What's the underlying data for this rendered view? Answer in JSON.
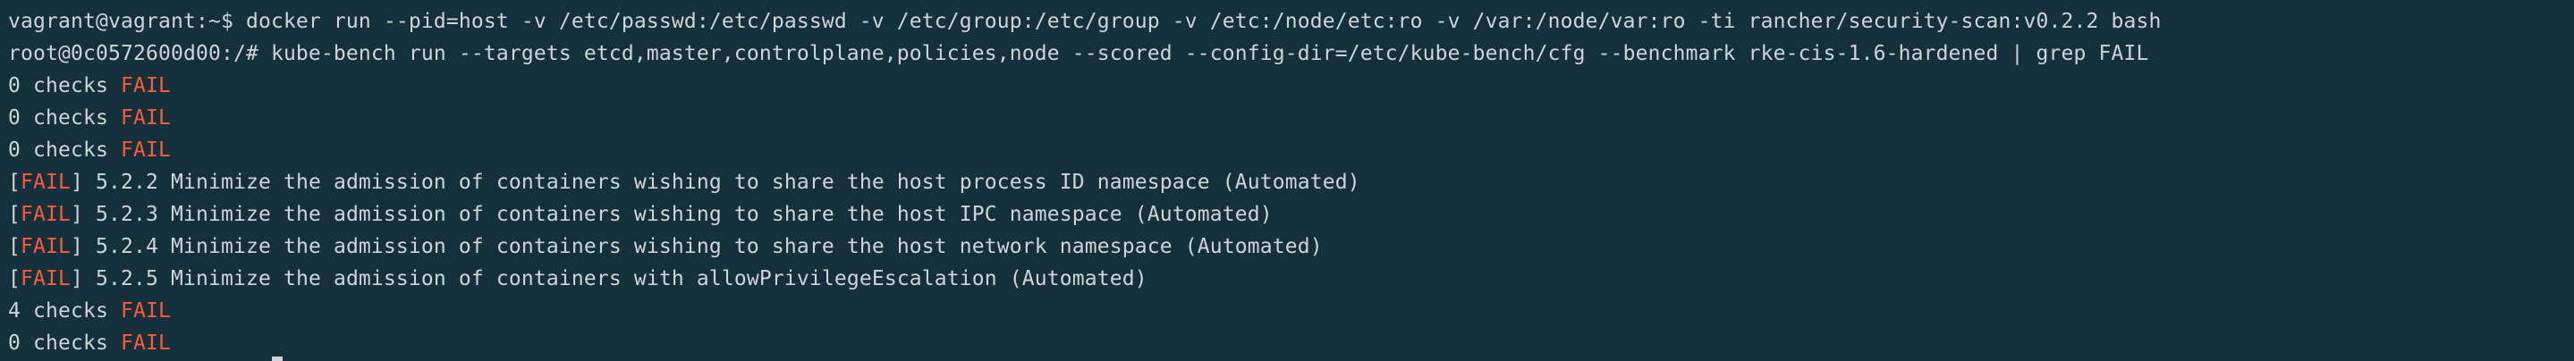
{
  "terminal": {
    "lines": [
      {
        "prefix": "vagrant@vagrant:~$ docker run --pid=host -v /etc/passwd:/etc/passwd -v /etc/group:/etc/group -v /etc:/node/etc:ro -v /var:/node/var:ro -ti rancher/security-scan:v0.2.2 bash",
        "fail": "",
        "suffix": ""
      },
      {
        "prefix": "root@0c0572600d00:/# kube-bench run --targets etcd,master,controlplane,policies,node --scored --config-dir=/etc/kube-bench/cfg --benchmark rke-cis-1.6-hardened | grep FAIL",
        "fail": "",
        "suffix": ""
      },
      {
        "prefix": "0 checks ",
        "fail": "FAIL",
        "suffix": ""
      },
      {
        "prefix": "0 checks ",
        "fail": "FAIL",
        "suffix": ""
      },
      {
        "prefix": "0 checks ",
        "fail": "FAIL",
        "suffix": ""
      },
      {
        "prefix": "[",
        "fail": "FAIL",
        "suffix": "] 5.2.2 Minimize the admission of containers wishing to share the host process ID namespace (Automated)"
      },
      {
        "prefix": "[",
        "fail": "FAIL",
        "suffix": "] 5.2.3 Minimize the admission of containers wishing to share the host IPC namespace (Automated)"
      },
      {
        "prefix": "[",
        "fail": "FAIL",
        "suffix": "] 5.2.4 Minimize the admission of containers wishing to share the host network namespace (Automated)"
      },
      {
        "prefix": "[",
        "fail": "FAIL",
        "suffix": "] 5.2.5 Minimize the admission of containers with allowPrivilegeEscalation (Automated)"
      },
      {
        "prefix": "4 checks ",
        "fail": "FAIL",
        "suffix": ""
      },
      {
        "prefix": "0 checks ",
        "fail": "FAIL",
        "suffix": ""
      }
    ]
  },
  "colors": {
    "background": "#13303c",
    "text": "#d0d4d6",
    "fail_highlight": "#ff5a36"
  }
}
